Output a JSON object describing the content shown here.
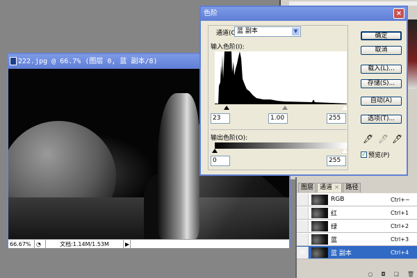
{
  "document": {
    "title": "222.jpg @ 66.7% (图层 0, 蓝 副本/8)",
    "zoom": "66.67%",
    "doc_size": "文档:1.14M/1.53M"
  },
  "levels": {
    "title": "色阶",
    "channel_label": "通道(C):",
    "channel_value": "蓝 副本",
    "input_label": "输入色阶(I):",
    "input_black": "23",
    "input_gamma": "1.00",
    "input_white": "255",
    "output_label": "输出色阶(O):",
    "output_black": "0",
    "output_white": "255",
    "buttons": {
      "ok": "确定",
      "cancel": "取消",
      "load": "载入(L)...",
      "save": "存储(S)...",
      "auto": "自动(A)",
      "options": "选项(T)..."
    },
    "preview_label": "预览(P)",
    "preview_checked": true
  },
  "channels_panel": {
    "tabs": [
      "图层",
      "通道",
      "路径"
    ],
    "rows": [
      {
        "name": "RGB",
        "shortcut": "Ctrl+~",
        "visible": false
      },
      {
        "name": "红",
        "shortcut": "Ctrl+1",
        "visible": false
      },
      {
        "name": "绿",
        "shortcut": "Ctrl+2",
        "visible": false
      },
      {
        "name": "蓝",
        "shortcut": "Ctrl+3",
        "visible": false
      },
      {
        "name": "蓝 副本",
        "shortcut": "Ctrl+4",
        "visible": true,
        "selected": true
      }
    ]
  }
}
